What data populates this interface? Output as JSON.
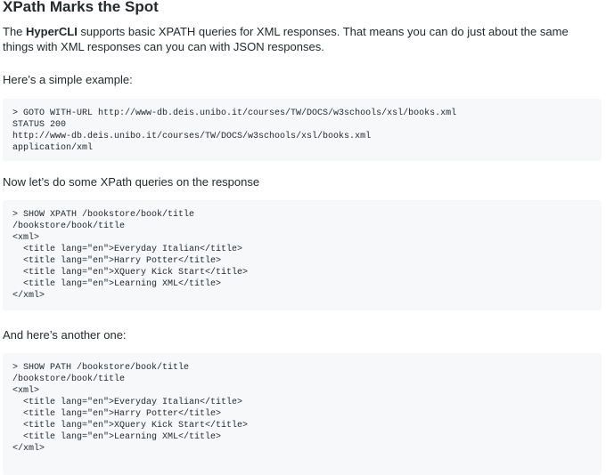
{
  "doc": {
    "heading": "XPath Marks the Spot",
    "intro": {
      "pre": "The ",
      "bold": "HyperCLI",
      "post": " supports basic XPATH queries for XML responses. That means you can do just about the same things with XML responses can you can with JSON responses."
    },
    "example_intro": "Here’s a simple example:",
    "code1": "> GOTO WITH-URL http://www-db.deis.unibo.it/courses/TW/DOCS/w3schools/xsl/books.xml\nSTATUS 200\nhttp://www-db.deis.unibo.it/courses/TW/DOCS/w3schools/xsl/books.xml\napplication/xml",
    "now_intro": "Now let’s do some XPath queries on the response",
    "code2": "> SHOW XPATH /bookstore/book/title\n/bookstore/book/title\n<xml>\n  <title lang=\"en\">Everyday Italian</title>\n  <title lang=\"en\">Harry Potter</title>\n  <title lang=\"en\">XQuery Kick Start</title>\n  <title lang=\"en\">Learning XML</title>\n</xml>",
    "another_intro": "And here’s another one:",
    "code3": "> SHOW PATH /bookstore/book/title\n/bookstore/book/title\n<xml>\n  <title lang=\"en\">Everyday Italian</title>\n  <title lang=\"en\">Harry Potter</title>\n  <title lang=\"en\">XQuery Kick Start</title>\n  <title lang=\"en\">Learning XML</title>\n</xml>"
  }
}
